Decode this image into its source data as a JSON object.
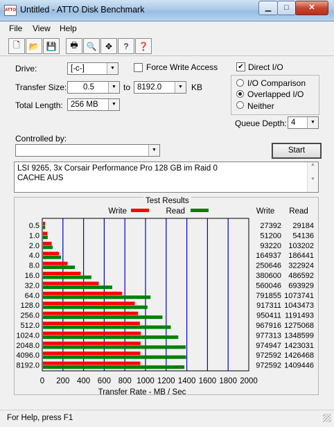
{
  "window": {
    "title": "Untitled - ATTO Disk Benchmark",
    "app_icon_text": "ATTO",
    "min_glyph": "▁",
    "max_glyph": "□",
    "close_glyph": "✕"
  },
  "menu": {
    "file": "File",
    "view": "View",
    "help": "Help"
  },
  "toolbar": {
    "icons": [
      "new-document-icon",
      "open-folder-icon",
      "save-icon",
      "print-icon",
      "print-preview-icon",
      "move-icon",
      "help-icon",
      "context-help-icon"
    ],
    "glyphs": [
      "🗋",
      "📂",
      "💾",
      "🖶",
      "🔍",
      "✥",
      "?",
      "❓"
    ]
  },
  "settings": {
    "drive_label": "Drive:",
    "drive_value": "[-c-]",
    "force_write_label": "Force Write Access",
    "direct_io_label": "Direct I/O",
    "direct_io_checked": "✔",
    "transfer_size_label": "Transfer Size:",
    "transfer_from": "0.5",
    "to_label": "to",
    "transfer_to": "8192.0",
    "kb_label": "KB",
    "total_length_label": "Total Length:",
    "total_length_value": "256 MB",
    "io_comparison_label": "I/O Comparison",
    "overlapped_io_label": "Overlapped I/O",
    "neither_label": "Neither",
    "queue_depth_label": "Queue Depth:",
    "queue_depth_value": "4",
    "controlled_by_label": "Controlled by:",
    "controlled_by_value": "",
    "start_label": "Start"
  },
  "description": {
    "line1": "LSI 9265, 3x Corsair Performance Pro 128 GB im Raid 0",
    "line2": "CACHE AUS"
  },
  "results": {
    "title": "Test Results",
    "write_label": "Write",
    "read_label": "Read",
    "col_write": "Write",
    "col_read": "Read",
    "xlabel": "Transfer Rate - MB / Sec",
    "write_color": "#ff0000",
    "read_color": "#008000"
  },
  "chart_data": {
    "type": "bar",
    "orientation": "horizontal",
    "categories": [
      "0.5",
      "1.0",
      "2.0",
      "4.0",
      "8.0",
      "16.0",
      "32.0",
      "64.0",
      "128.0",
      "256.0",
      "512.0",
      "1024.0",
      "2048.0",
      "4096.0",
      "8192.0"
    ],
    "series": [
      {
        "name": "Write",
        "values": [
          27392,
          51200,
          93220,
          164937,
          250646,
          380600,
          560046,
          791855,
          917311,
          950411,
          967916,
          977313,
          974947,
          972592,
          972592
        ]
      },
      {
        "name": "Read",
        "values": [
          29184,
          54136,
          103202,
          186441,
          322924,
          486592,
          693929,
          1073741,
          1043473,
          1191493,
          1275068,
          1348599,
          1423031,
          1426468,
          1409446
        ]
      }
    ],
    "xticks": [
      "0",
      "200",
      "400",
      "600",
      "800",
      "1000",
      "1200",
      "1400",
      "1600",
      "1800",
      "2000"
    ],
    "xlim": [
      0,
      2000
    ],
    "xlabel": "Transfer Rate - MB / Sec",
    "legend": "top"
  },
  "status": {
    "text": "For Help, press F1"
  }
}
